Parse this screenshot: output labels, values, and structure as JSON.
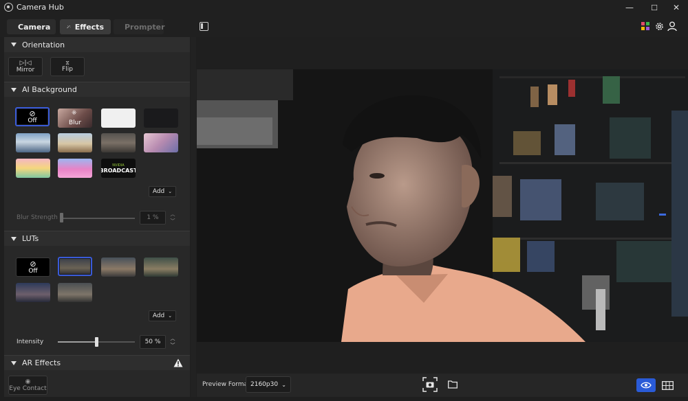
{
  "window": {
    "title": "Camera Hub",
    "controls": [
      "—",
      "☐",
      "✕"
    ]
  },
  "tabs": [
    {
      "label": "Camera",
      "icon": "camera-icon",
      "state": "default"
    },
    {
      "label": "Effects",
      "icon": "magic-wand-icon",
      "state": "active"
    },
    {
      "label": "Prompter",
      "icon": "prompter-icon",
      "state": "disabled"
    }
  ],
  "top_right_icons": [
    "plugins-icon",
    "settings-gear-icon",
    "user-icon"
  ],
  "orientation": {
    "title": "Orientation",
    "buttons": [
      {
        "label": "Mirror",
        "icon": "mirror-icon"
      },
      {
        "label": "Flip",
        "icon": "flip-icon"
      }
    ]
  },
  "ai_background": {
    "title": "AI Background",
    "thumbnails": [
      {
        "label": "Off",
        "kind": "off",
        "selected": true
      },
      {
        "label": "Blur",
        "kind": "blur"
      },
      {
        "label": "",
        "kind": "white"
      },
      {
        "label": "",
        "kind": "black"
      },
      {
        "label": "",
        "kind": "office"
      },
      {
        "label": "",
        "kind": "living-room"
      },
      {
        "label": "",
        "kind": "kitchen"
      },
      {
        "label": "",
        "kind": "pink-room"
      },
      {
        "label": "",
        "kind": "cartoon-room"
      },
      {
        "label": "",
        "kind": "pink-cartoon"
      },
      {
        "label": "BROADCAST",
        "kind": "nvidia-broadcast",
        "brand": "NVIDIA"
      }
    ],
    "add_label": "Add",
    "blur_strength": {
      "label": "Blur Strength",
      "value": "1 %",
      "level": 0.01
    }
  },
  "luts": {
    "title": "LUTs",
    "thumbnails": [
      {
        "label": "Off",
        "kind": "off"
      },
      {
        "label": "",
        "kind": "lut-1",
        "selected": true
      },
      {
        "label": "",
        "kind": "lut-2"
      },
      {
        "label": "",
        "kind": "lut-3"
      },
      {
        "label": "",
        "kind": "lut-4"
      },
      {
        "label": "",
        "kind": "lut-5"
      }
    ],
    "add_label": "Add",
    "intensity": {
      "label": "Intensity",
      "value": "50 %",
      "level": 0.5
    }
  },
  "ar_effects": {
    "title": "AR Effects",
    "warning_icon": "warning-icon",
    "button": {
      "label": "Eye Contact",
      "icon": "eye-contact-icon"
    }
  },
  "bottom_bar": {
    "preview_format_label": "Preview Format",
    "preview_format_value": "2160p30",
    "icons": [
      "snapshot-icon",
      "folder-icon",
      "preview-eye-icon",
      "grid-icon"
    ]
  },
  "colors": {
    "accent": "#2a5bd7",
    "selected_border": "#3a5bd9",
    "shirt": "#e8a98c"
  }
}
